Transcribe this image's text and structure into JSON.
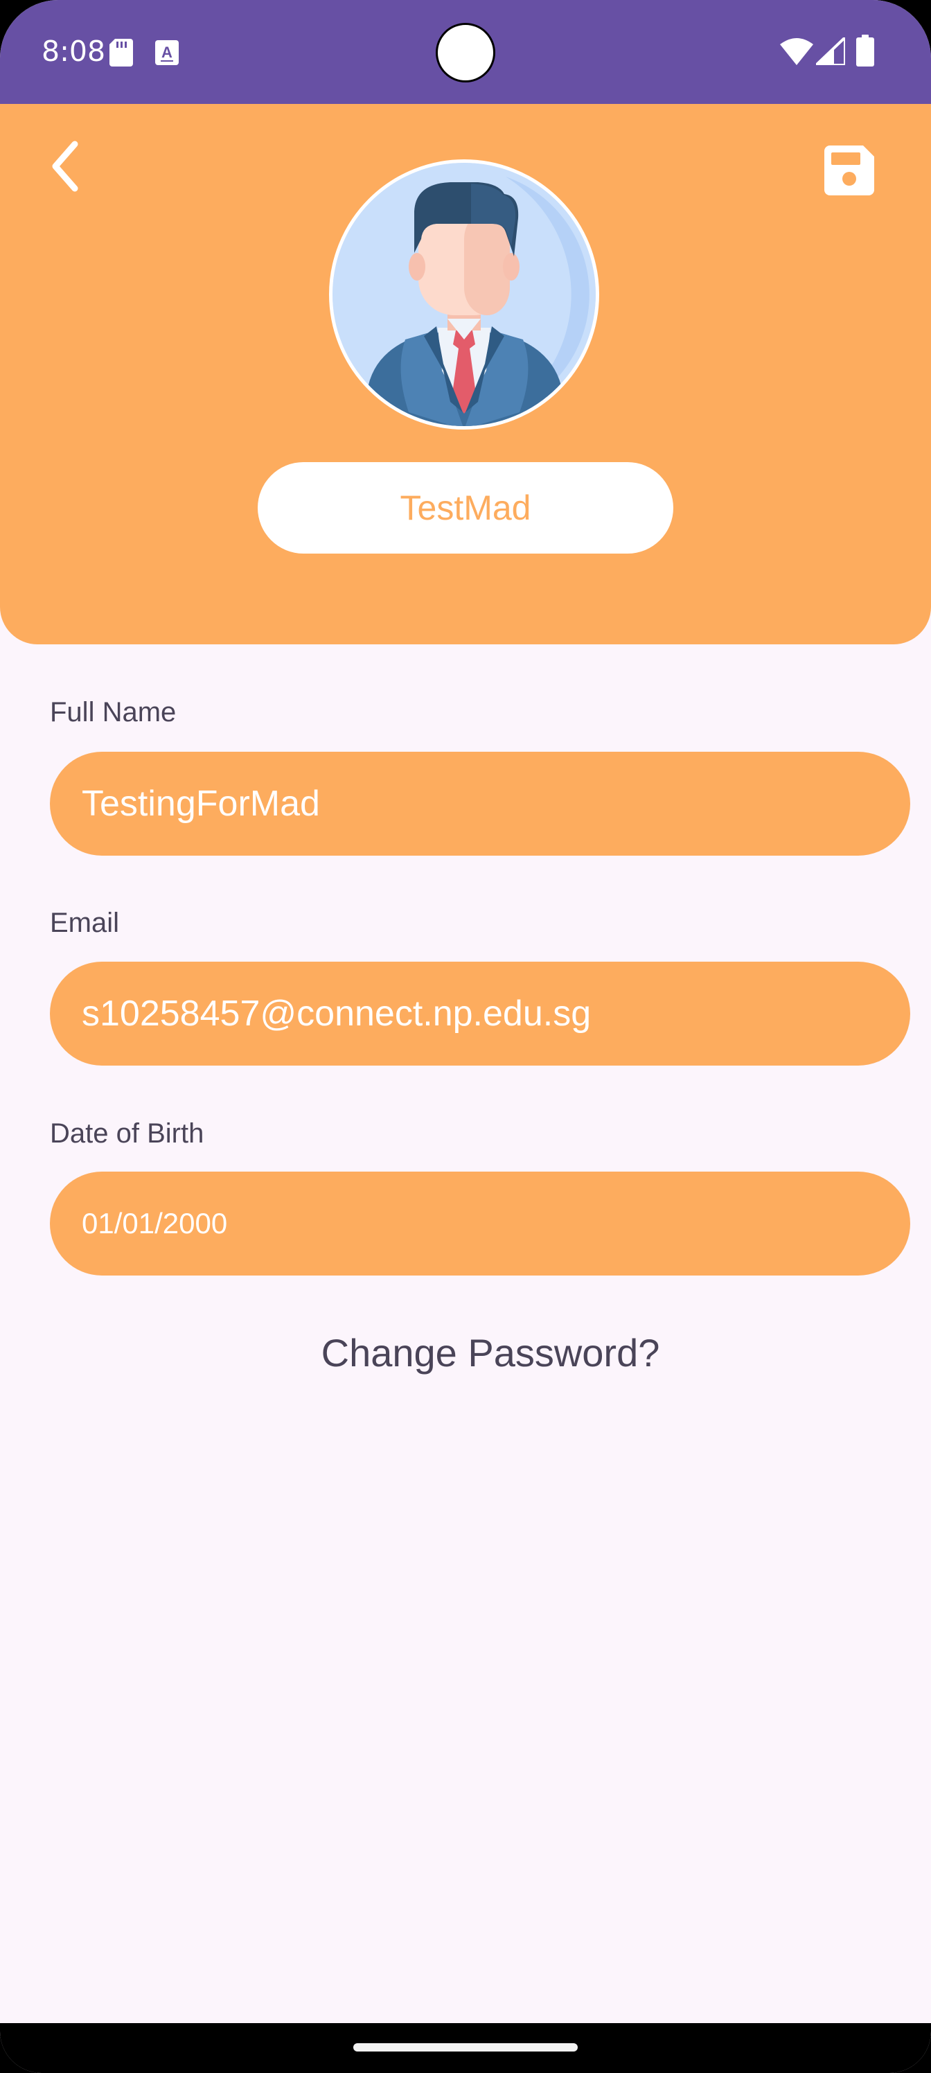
{
  "status_bar": {
    "time": "8:08",
    "icons": [
      "sd-card-icon",
      "keyboard-a-icon",
      "wifi-icon",
      "signal-icon",
      "battery-icon"
    ],
    "background": "#6750A4"
  },
  "header": {
    "background": "#FDAC5E",
    "back_icon": "chevron-left-icon",
    "save_icon": "floppy-disk-icon",
    "avatar_icon": "businessman-avatar-icon",
    "username": "TestMad"
  },
  "form": {
    "full_name": {
      "label": "Full Name",
      "value": "TestingForMad"
    },
    "email": {
      "label": "Email",
      "value": "s10258457@connect.np.edu.sg"
    },
    "dob": {
      "label": "Date of Birth",
      "value": "01/01/2000"
    }
  },
  "change_password_label": "Change Password?",
  "colors": {
    "accent": "#FDAC5E",
    "status_bar": "#6750A4",
    "background": "#FCF5FC",
    "label_text": "#4A4458"
  }
}
